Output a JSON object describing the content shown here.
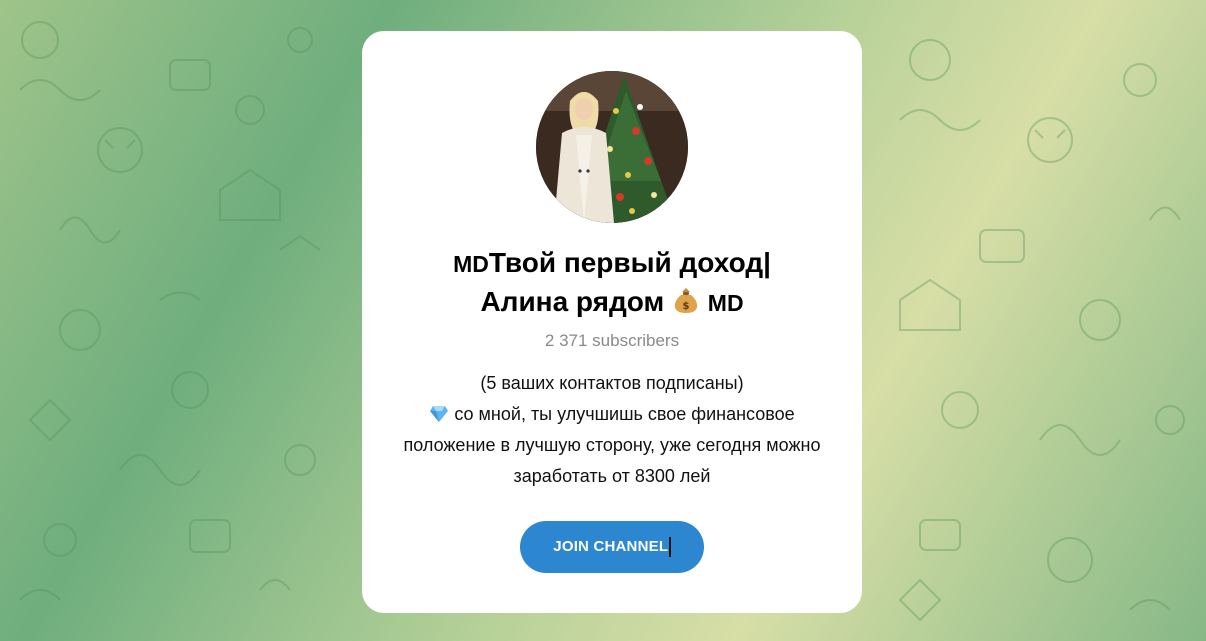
{
  "channel": {
    "title_prefix": "MD",
    "title_line1": "Твой первый доход|",
    "title_line2": "Алина рядом",
    "title_suffix": "MD",
    "money_bag_icon": "money-bag-emoji",
    "subscribers": "2 371 subscribers",
    "description_line1": "(5 ваших контактов подписаны)",
    "description_line2": "со мной, ты улучшишь свое финансовое положение в лучшую сторону, уже сегодня можно заработать от 8300 лей",
    "diamond_icon": "gem-emoji",
    "join_label": "JOIN CHANNEL"
  },
  "colors": {
    "button": "#2d87d0",
    "card": "#ffffff",
    "subscribers_text": "#8a8a8a"
  }
}
